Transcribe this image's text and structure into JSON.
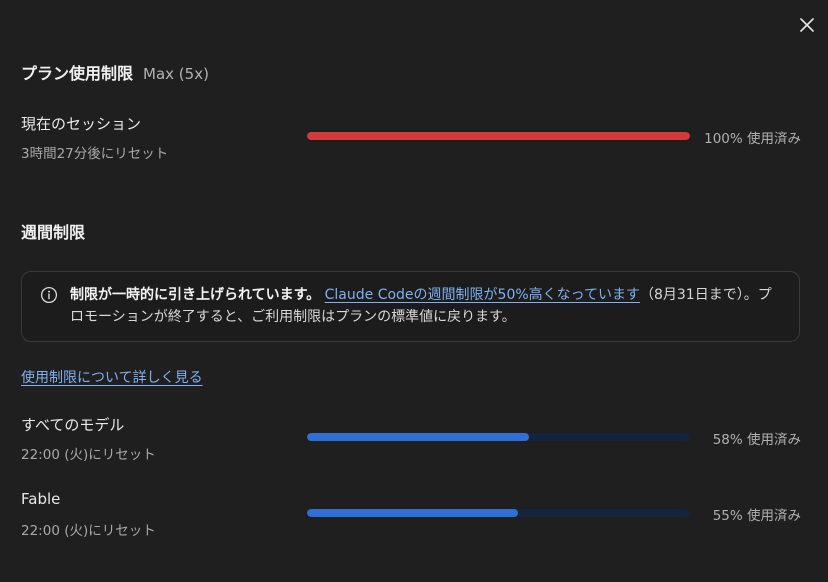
{
  "dialog": {
    "close_icon": "close-icon"
  },
  "plan": {
    "title": "プラン使用制限",
    "tier": "Max (5x)"
  },
  "session": {
    "label": "現在のセッション",
    "reset": "3時間27分後にリセット",
    "percent": 100,
    "percent_label": "100% 使用済み",
    "color": "#d13b3b"
  },
  "weekly": {
    "heading": "週間制限",
    "notice": {
      "icon": "info-icon",
      "bold": "制限が一時的に引き上げられています。",
      "link": "Claude Codeの週間制限が50%高くなっています",
      "rest": "（8月31日まで）。プロモーションが終了すると、ご利用制限はプランの標準値に戻ります。"
    },
    "learn_more": "使用制限について詳しく見る",
    "models": [
      {
        "label": "すべてのモデル",
        "reset": "22:00 (火)にリセット",
        "percent": 58,
        "percent_label": "58% 使用済み",
        "color": "#2f6fd6"
      },
      {
        "label": "Fable",
        "reset": "22:00 (火)にリセット",
        "percent": 55,
        "percent_label": "55% 使用済み",
        "color": "#2f6fd6"
      }
    ]
  },
  "colors": {
    "background": "#1f1f1f",
    "link": "#7fb0f0",
    "track": "#14243c"
  }
}
